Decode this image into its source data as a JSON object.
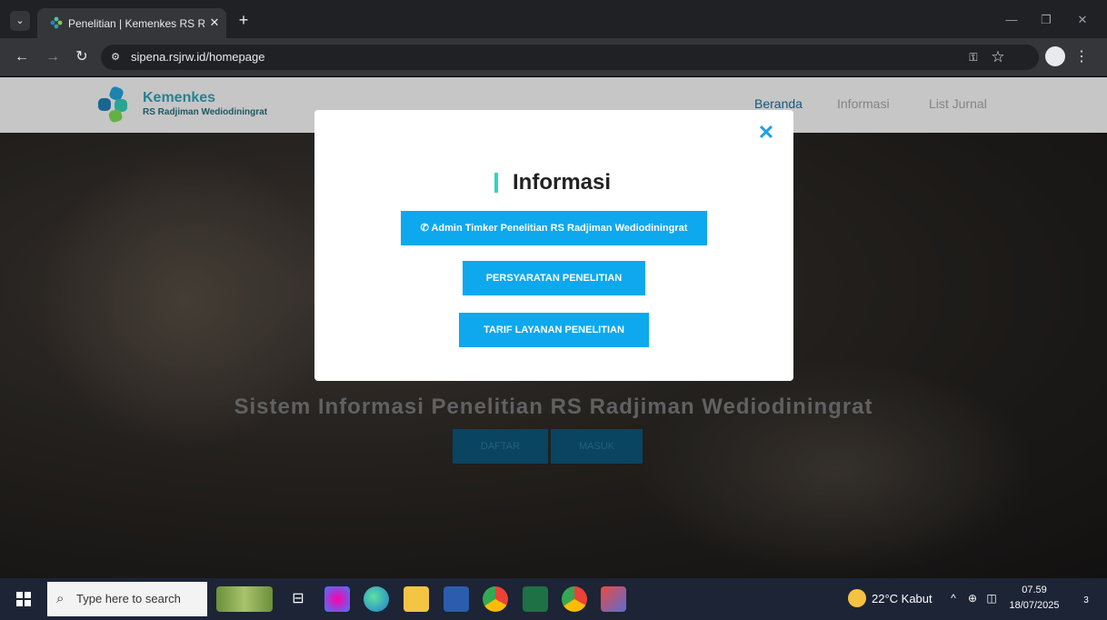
{
  "browser": {
    "tab_title": "Penelitian | Kemenkes RS Radjim",
    "tab_close": "✕",
    "new_tab": "+",
    "url": "sipena.rsjrw.id/homepage",
    "icons": [
      "tab-search-icon",
      "back-icon",
      "forward-icon",
      "reload-icon",
      "site-info-icon",
      "password-key-icon",
      "star-icon",
      "profile-icon",
      "menu-icon",
      "minimize-icon",
      "restore-icon",
      "close-icon"
    ]
  },
  "site": {
    "logo_name": "Kemenkes",
    "logo_sub": "RS Radjiman Wediodiningrat",
    "nav": [
      "Beranda",
      "Informasi",
      "List Jurnal"
    ],
    "nav_active_color": "#1a5f8a",
    "hero_title": "Sistem Informasi Penelitian RS Radjiman Wediodiningrat",
    "hero_buttons": [
      "DAFTAR",
      "MASUK"
    ]
  },
  "modal": {
    "title": "Informasi",
    "close": "✕",
    "admin_button": "Admin Timker Penelitian RS Radjiman Wediodiningrat",
    "requirements_button": "PERSYARATAN PENELITIAN",
    "tariff_button": "TARIF LAYANAN PENELITIAN",
    "accent_color": "#2fd6c0",
    "button_color": "#0ea8ee"
  },
  "taskbar": {
    "search_placeholder": "Type here to search",
    "weather": "22°C  Kabut",
    "time": "07.59",
    "date": "18/07/2025",
    "notifications": "3",
    "apps": [
      "task-view-icon",
      "copilot-icon",
      "edge-icon",
      "file-explorer-icon",
      "word-icon",
      "chrome-icon",
      "excel-icon",
      "chrome-profile-icon",
      "app-icon"
    ]
  }
}
